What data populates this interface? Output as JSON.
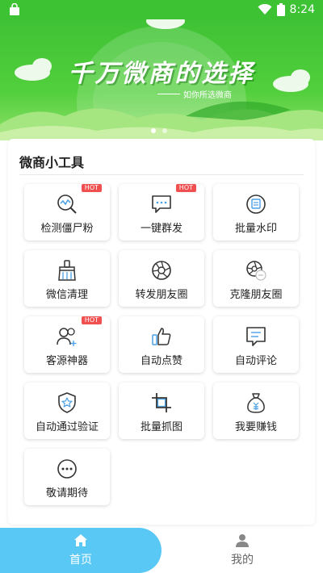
{
  "status_bar": {
    "time": "8:24"
  },
  "banner": {
    "title": "千万微商的选择",
    "subtitle": "如你所选微商"
  },
  "section": {
    "title": "微商小工具"
  },
  "tools": [
    {
      "label": "检测僵尸粉",
      "icon": "search-chart-icon",
      "hot": "HOT"
    },
    {
      "label": "一键群发",
      "icon": "chat-bubble-icon",
      "hot": "HOT"
    },
    {
      "label": "批量水印",
      "icon": "stamp-icon"
    },
    {
      "label": "微信清理",
      "icon": "broom-icon"
    },
    {
      "label": "转发朋友圈",
      "icon": "aperture-icon"
    },
    {
      "label": "克隆朋友圈",
      "icon": "aperture-clone-icon"
    },
    {
      "label": "客源神器",
      "icon": "users-add-icon",
      "hot": "HOT"
    },
    {
      "label": "自动点赞",
      "icon": "thumbs-up-icon"
    },
    {
      "label": "自动评论",
      "icon": "comment-icon"
    },
    {
      "label": "自动通过验证",
      "icon": "shield-star-icon"
    },
    {
      "label": "批量抓图",
      "icon": "crop-icon"
    },
    {
      "label": "我要赚钱",
      "icon": "money-bag-icon"
    },
    {
      "label": "敬请期待",
      "icon": "more-icon"
    }
  ],
  "bottom_nav": {
    "home_label": "首页",
    "mine_label": "我的"
  },
  "colors": {
    "banner": "#3fc235",
    "nav_active": "#5ac8f5",
    "hot_badge": "#f05050"
  }
}
